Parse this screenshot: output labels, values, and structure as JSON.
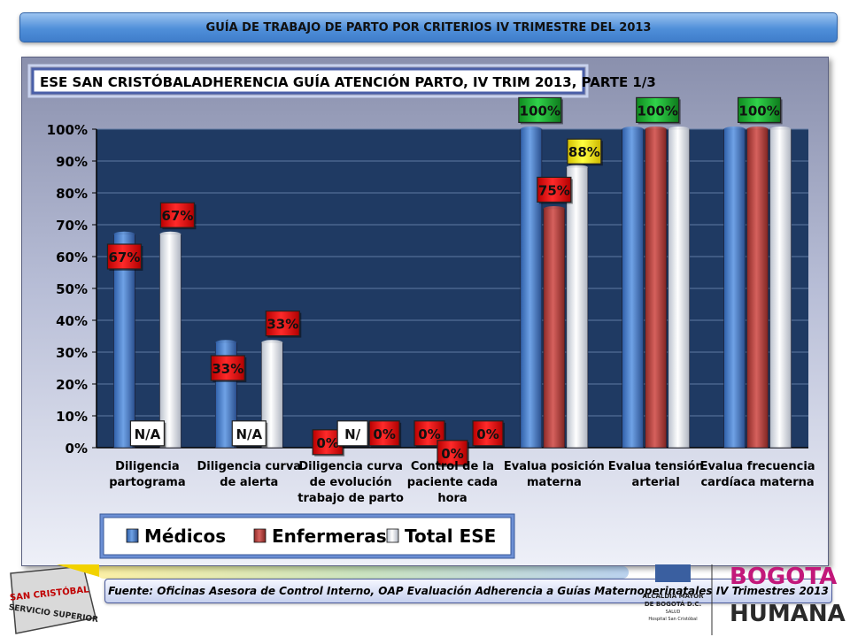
{
  "banner": {
    "title": "GUÍA DE TRABAJO DE PARTO  POR CRITERIOS IV TRIMESTRE DEL 2013"
  },
  "chart_data": {
    "type": "bar",
    "title": "ESE SAN CRISTÓBALADHERENCIA  GUÍA ATENCIÓN PARTO, IV TRIM 2013, PARTE 1/3",
    "ylim": [
      0,
      100
    ],
    "yticks": [
      "0%",
      "10%",
      "20%",
      "30%",
      "40%",
      "50%",
      "60%",
      "70%",
      "80%",
      "90%",
      "100%"
    ],
    "categories": [
      [
        "Diligencia",
        "partograma"
      ],
      [
        "Diligencia curva",
        "de alerta"
      ],
      [
        "Diligencia curva",
        "de evolución",
        "trabajo de parto"
      ],
      [
        "Control de la",
        "paciente cada",
        "hora"
      ],
      [
        "Evalua posición",
        "materna"
      ],
      [
        "Evalua tensión",
        "arterial"
      ],
      [
        "Evalua frecuencia",
        "cardíaca materna"
      ]
    ],
    "series": [
      {
        "name": "Médicos",
        "color": "#4a7fc8",
        "values": [
          67,
          33,
          null,
          0,
          100,
          100,
          100
        ],
        "labels": [
          "67%",
          "33%",
          "0%",
          "0%",
          "100%",
          "100%",
          "100%"
        ]
      },
      {
        "name": "Enfermeras",
        "color": "#c0504d",
        "values": [
          null,
          null,
          null,
          0,
          75,
          100,
          100
        ],
        "labels": [
          "N/A",
          "N/A",
          "N/",
          "0%",
          "75%",
          "",
          ""
        ]
      },
      {
        "name": "Total ESE",
        "color": "#e8ecf4",
        "values": [
          67,
          33,
          0,
          0,
          88,
          100,
          100
        ],
        "labels": [
          "67%",
          "33%",
          "0%",
          "0%",
          "88%",
          "",
          ""
        ]
      }
    ],
    "legend": "bottom"
  },
  "footer": {
    "source": "Fuente: Oficinas Asesora de Control Interno, OAP Evaluación Adherencia a Guías Maternoperinatales IV Trimestres 2013"
  },
  "branding": {
    "left_line1": "SAN CRISTÓBAL",
    "left_line2": "SERVICIO SUPERIOR",
    "right_line1": "ALCALDÍA MAYOR",
    "right_line2": "DE BOGOTÁ D.C.",
    "right_line3": "SALUD",
    "right_line4": "Hospital San Cristóbal",
    "right_logo_top": "BOGOTA",
    "right_logo_bottom": "HUMANA"
  }
}
